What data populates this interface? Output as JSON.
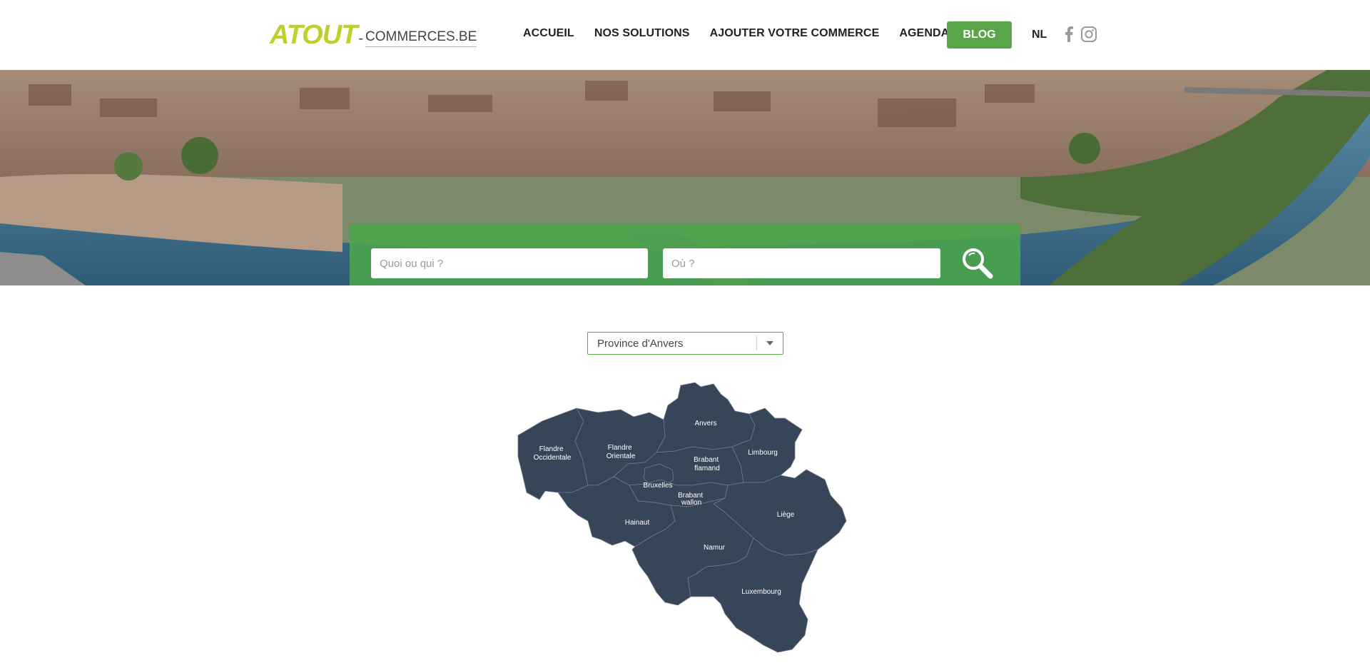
{
  "logo": {
    "mark": "ATOUT",
    "dash": "-",
    "rest": "COMMERCES.BE"
  },
  "nav": {
    "items": [
      "ACCUEIL",
      "NOS SOLUTIONS",
      "AJOUTER VOTRE COMMERCE",
      "AGENDA"
    ],
    "blog": "BLOG",
    "lang": "NL"
  },
  "social": {
    "icons": [
      "facebook-icon",
      "instagram-icon"
    ]
  },
  "search": {
    "what_placeholder": "Quoi ou qui ?",
    "where_placeholder": "Où ?",
    "button_icon": "search-icon"
  },
  "province_select": {
    "value": "Province d'Anvers"
  },
  "map": {
    "regions": [
      {
        "id": "flandre-occidentale",
        "label_lines": [
          "Flandre",
          "Occidentale"
        ]
      },
      {
        "id": "flandre-orientale",
        "label_lines": [
          "Flandre",
          "Orientale"
        ]
      },
      {
        "id": "anvers",
        "label_lines": [
          "Anvers"
        ]
      },
      {
        "id": "limbourg",
        "label_lines": [
          "Limbourg"
        ]
      },
      {
        "id": "brabant-flamand",
        "label_lines": [
          "Brabant",
          "flamand"
        ]
      },
      {
        "id": "bruxelles",
        "label_lines": [
          "Bruxelles"
        ]
      },
      {
        "id": "brabant-wallon",
        "label_lines": [
          "Brabant",
          "wallon"
        ]
      },
      {
        "id": "hainaut",
        "label_lines": [
          "Hainaut"
        ]
      },
      {
        "id": "liege",
        "label_lines": [
          "Liège"
        ]
      },
      {
        "id": "namur",
        "label_lines": [
          "Namur"
        ]
      },
      {
        "id": "luxembourg",
        "label_lines": [
          "Luxembourg"
        ]
      }
    ]
  },
  "colors": {
    "brand_green": "#59a64a",
    "logo_lime": "#bfd02c",
    "map_fill": "#374559"
  }
}
